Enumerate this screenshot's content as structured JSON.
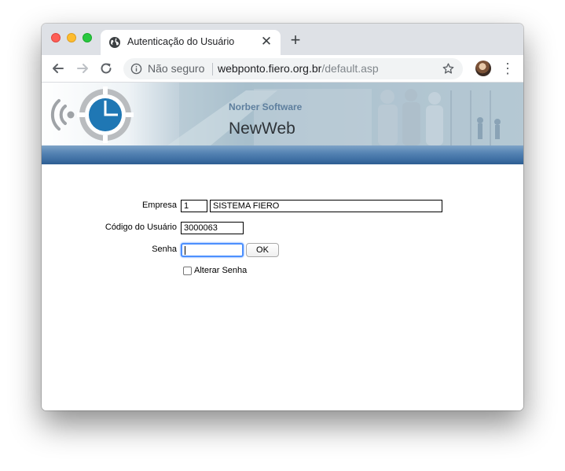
{
  "browser": {
    "tab": {
      "title": "Autenticação do Usuário",
      "close_symbol": "✕",
      "icon": "globe-icon"
    },
    "new_tab_symbol": "+",
    "toolbar": {
      "back_icon": "back-arrow-icon",
      "forward_icon": "forward-arrow-icon",
      "reload_icon": "reload-icon",
      "security_label": "Não seguro",
      "url_host": "webponto.fiero.org.br",
      "url_path": "/default.asp",
      "bookmark_icon": "star-icon",
      "menu_symbol": "⋮"
    }
  },
  "banner": {
    "company": "Norber Software",
    "product": "NewWeb",
    "accent_color": "#3e6fa3"
  },
  "form": {
    "empresa": {
      "label": "Empresa",
      "code": "1",
      "name": "SISTEMA FIERO"
    },
    "codigo": {
      "label": "Código do Usuário",
      "value": "3000063"
    },
    "senha": {
      "label": "Senha",
      "value": ""
    },
    "ok_label": "OK",
    "alterar_senha": {
      "label": "Alterar Senha",
      "checked": false
    }
  }
}
